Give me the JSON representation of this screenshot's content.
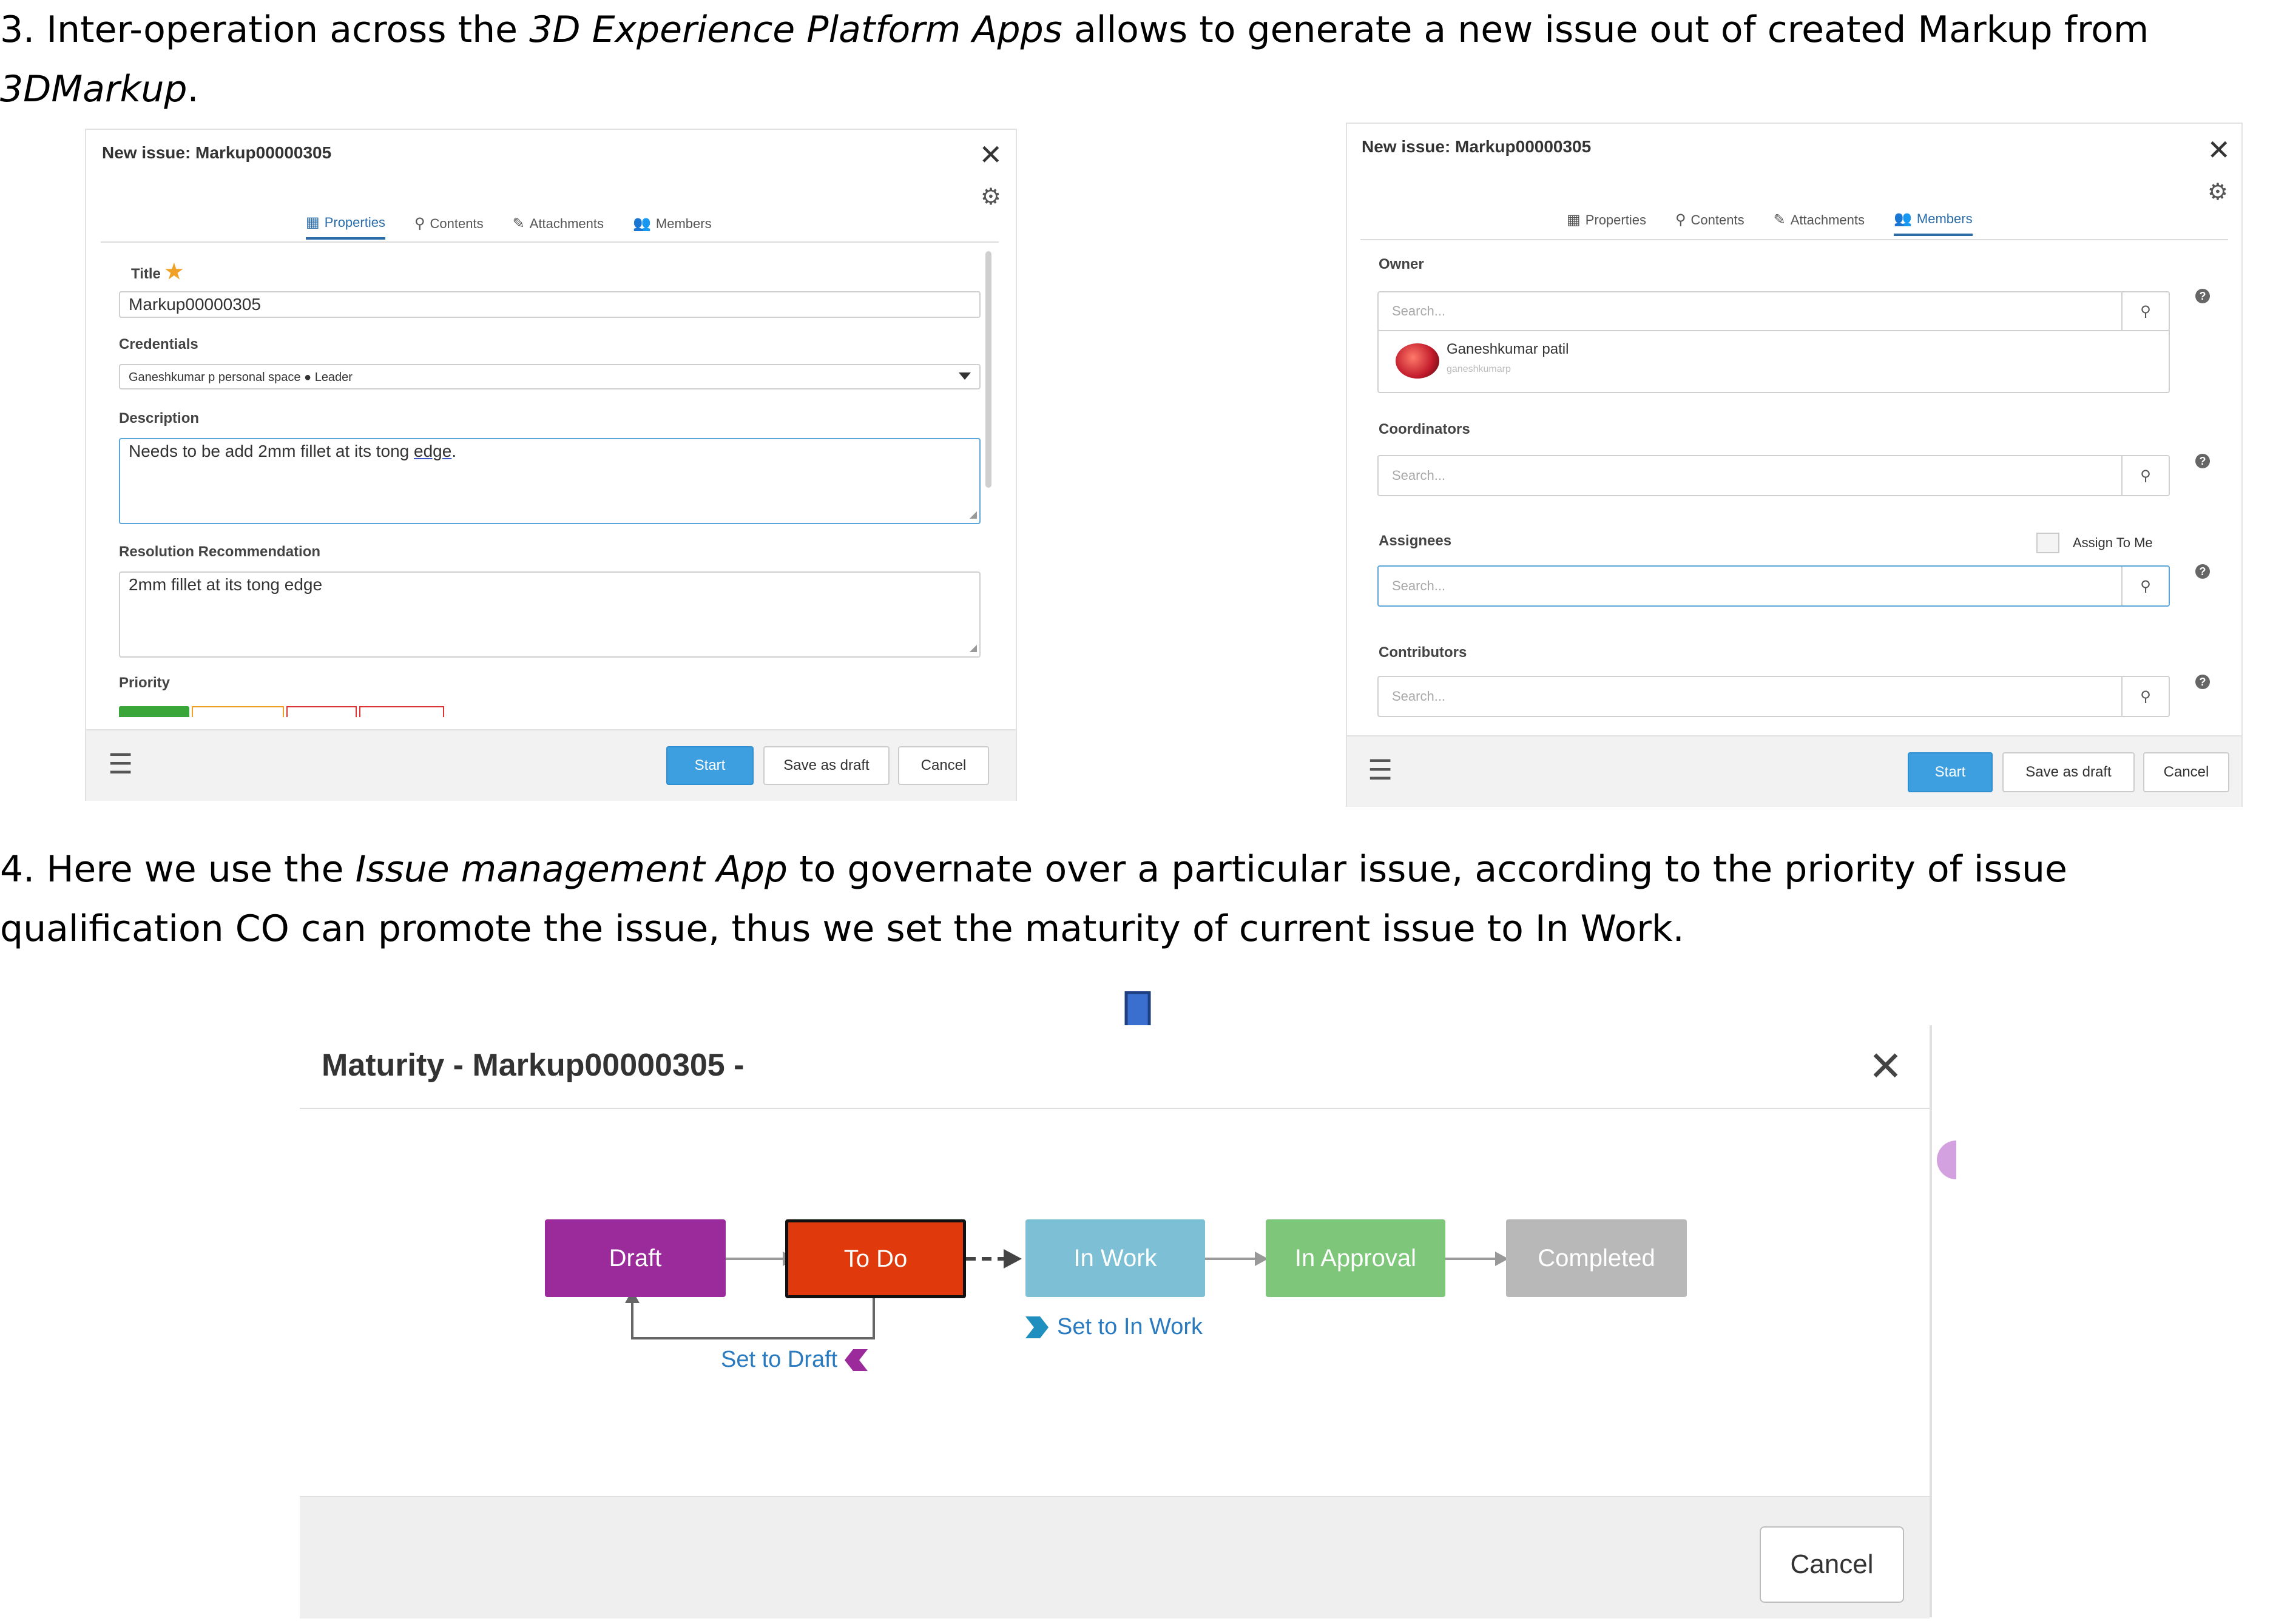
{
  "step3": {
    "prefix": "3. Inter-operation across the ",
    "app_italic": "3D Experience Platform Apps",
    "middle": " allows to generate a new issue out of created Markup from",
    "markup_italic": "3DMarkup",
    "suffix": "."
  },
  "dialog_props": {
    "title": "New issue: Markup00000305",
    "tabs": [
      "Properties",
      "Contents",
      "Attachments",
      "Members"
    ],
    "title_label": "Title",
    "title_value": "Markup00000305",
    "credentials_label": "Credentials",
    "credentials_value": "Ganeshkumar p personal space ● Leader",
    "description_label": "Description",
    "description_value_a": "Needs to be add 2mm fillet at its tong ",
    "description_value_b": "edge",
    "description_value_c": ".",
    "resolution_label": "Resolution Recommendation",
    "resolution_value": "2mm fillet at its tong edge",
    "priority_label": "Priority",
    "buttons": {
      "start": "Start",
      "draft": "Save as draft",
      "cancel": "Cancel"
    }
  },
  "dialog_members": {
    "title": "New issue: Markup00000305",
    "tabs": [
      "Properties",
      "Contents",
      "Attachments",
      "Members"
    ],
    "owner_label": "Owner",
    "search_placeholder": "Search...",
    "owner_name": "Ganeshkumar patil",
    "owner_login": "ganeshkumarp",
    "coordinators_label": "Coordinators",
    "assignees_label": "Assignees",
    "assign_to_me": "Assign To Me",
    "contributors_label": "Contributors",
    "buttons": {
      "start": "Start",
      "draft": "Save as draft",
      "cancel": "Cancel"
    }
  },
  "step4": {
    "prefix": "4. Here we use the ",
    "app_italic": "Issue management App",
    "line1_rest": " to governate over a particular issue, according to the priority of issue",
    "line2": "qualification CO can promote the issue, thus we set the maturity of current issue to In Work."
  },
  "maturity": {
    "title": "Maturity - Markup00000305 -",
    "states": [
      {
        "label": "Draft",
        "color": "#9b2a9b"
      },
      {
        "label": "To Do",
        "color": "#e03a0c"
      },
      {
        "label": "In Work",
        "color": "#7dbfd4"
      },
      {
        "label": "In Approval",
        "color": "#7dc67a"
      },
      {
        "label": "Completed",
        "color": "#b8b8b8"
      }
    ],
    "set_to_draft": "Set to Draft",
    "set_to_in_work": "Set to In Work",
    "cancel": "Cancel",
    "arrow_color": "#2f5fb0"
  }
}
